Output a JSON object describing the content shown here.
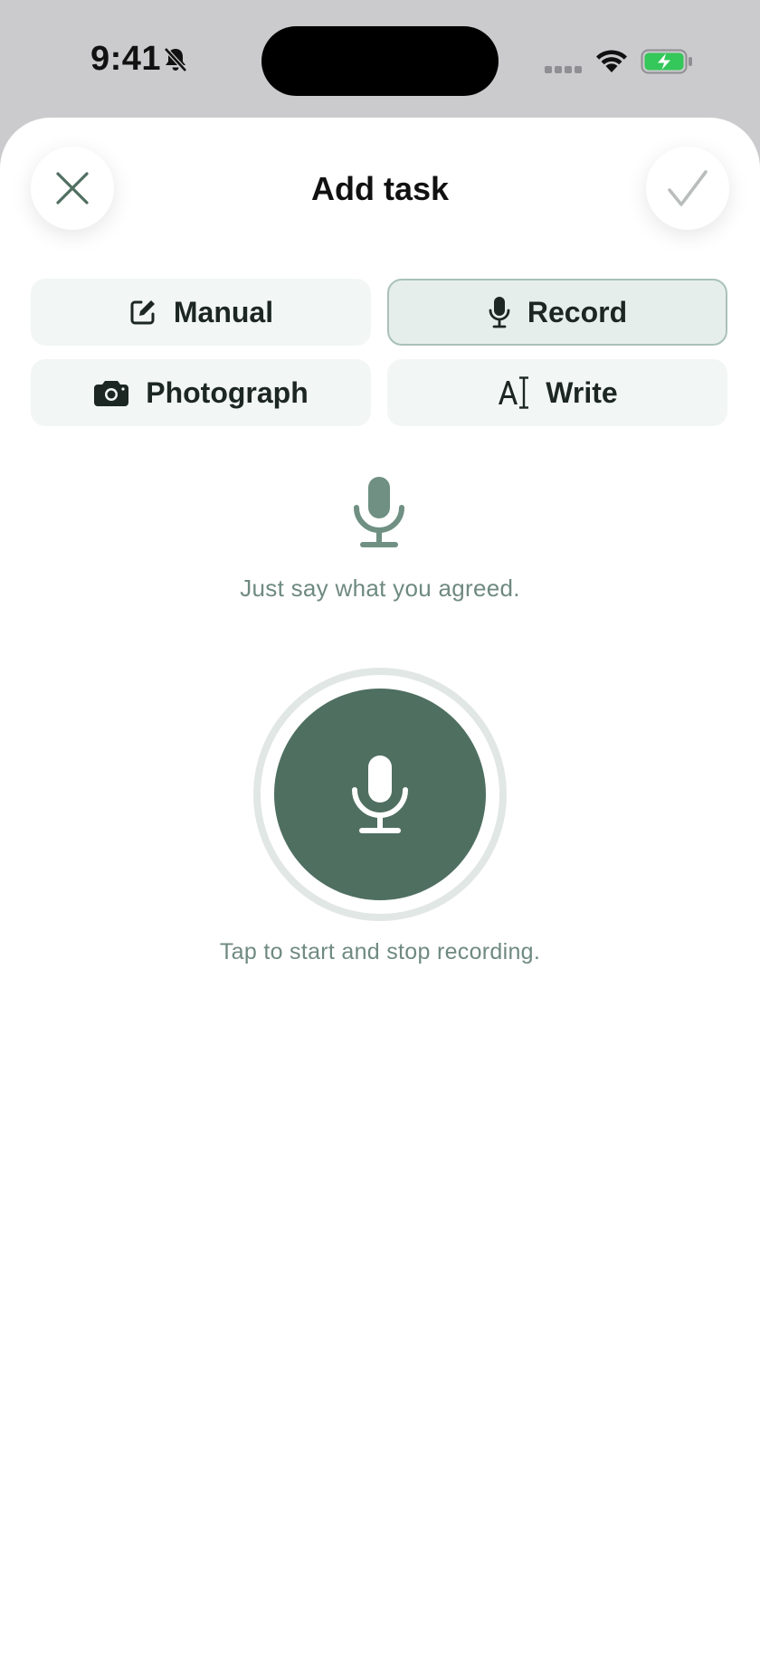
{
  "status_bar": {
    "time": "9:41",
    "icons": [
      "bell-slash-icon",
      "cellular-dots-icon",
      "wifi-icon",
      "battery-charging-icon"
    ]
  },
  "header": {
    "title": "Add task",
    "close_icon": "close-icon",
    "confirm_icon": "checkmark-icon"
  },
  "modes": [
    {
      "label": "Manual",
      "icon": "edit-icon",
      "selected": false
    },
    {
      "label": "Record",
      "icon": "microphone-icon",
      "selected": true
    },
    {
      "label": "Photograph",
      "icon": "camera-icon",
      "selected": false
    },
    {
      "label": "Write",
      "icon": "text-cursor-icon",
      "selected": false
    }
  ],
  "record_panel": {
    "hint": "Just say what you agreed.",
    "instruction": "Tap to start and stop recording."
  },
  "colors": {
    "accent": "#4f6f61",
    "muted_text": "#6f8a80",
    "battery": "#34c759",
    "mode_background": "#f2f6f5",
    "mode_selected_background": "#e6eeeb"
  }
}
